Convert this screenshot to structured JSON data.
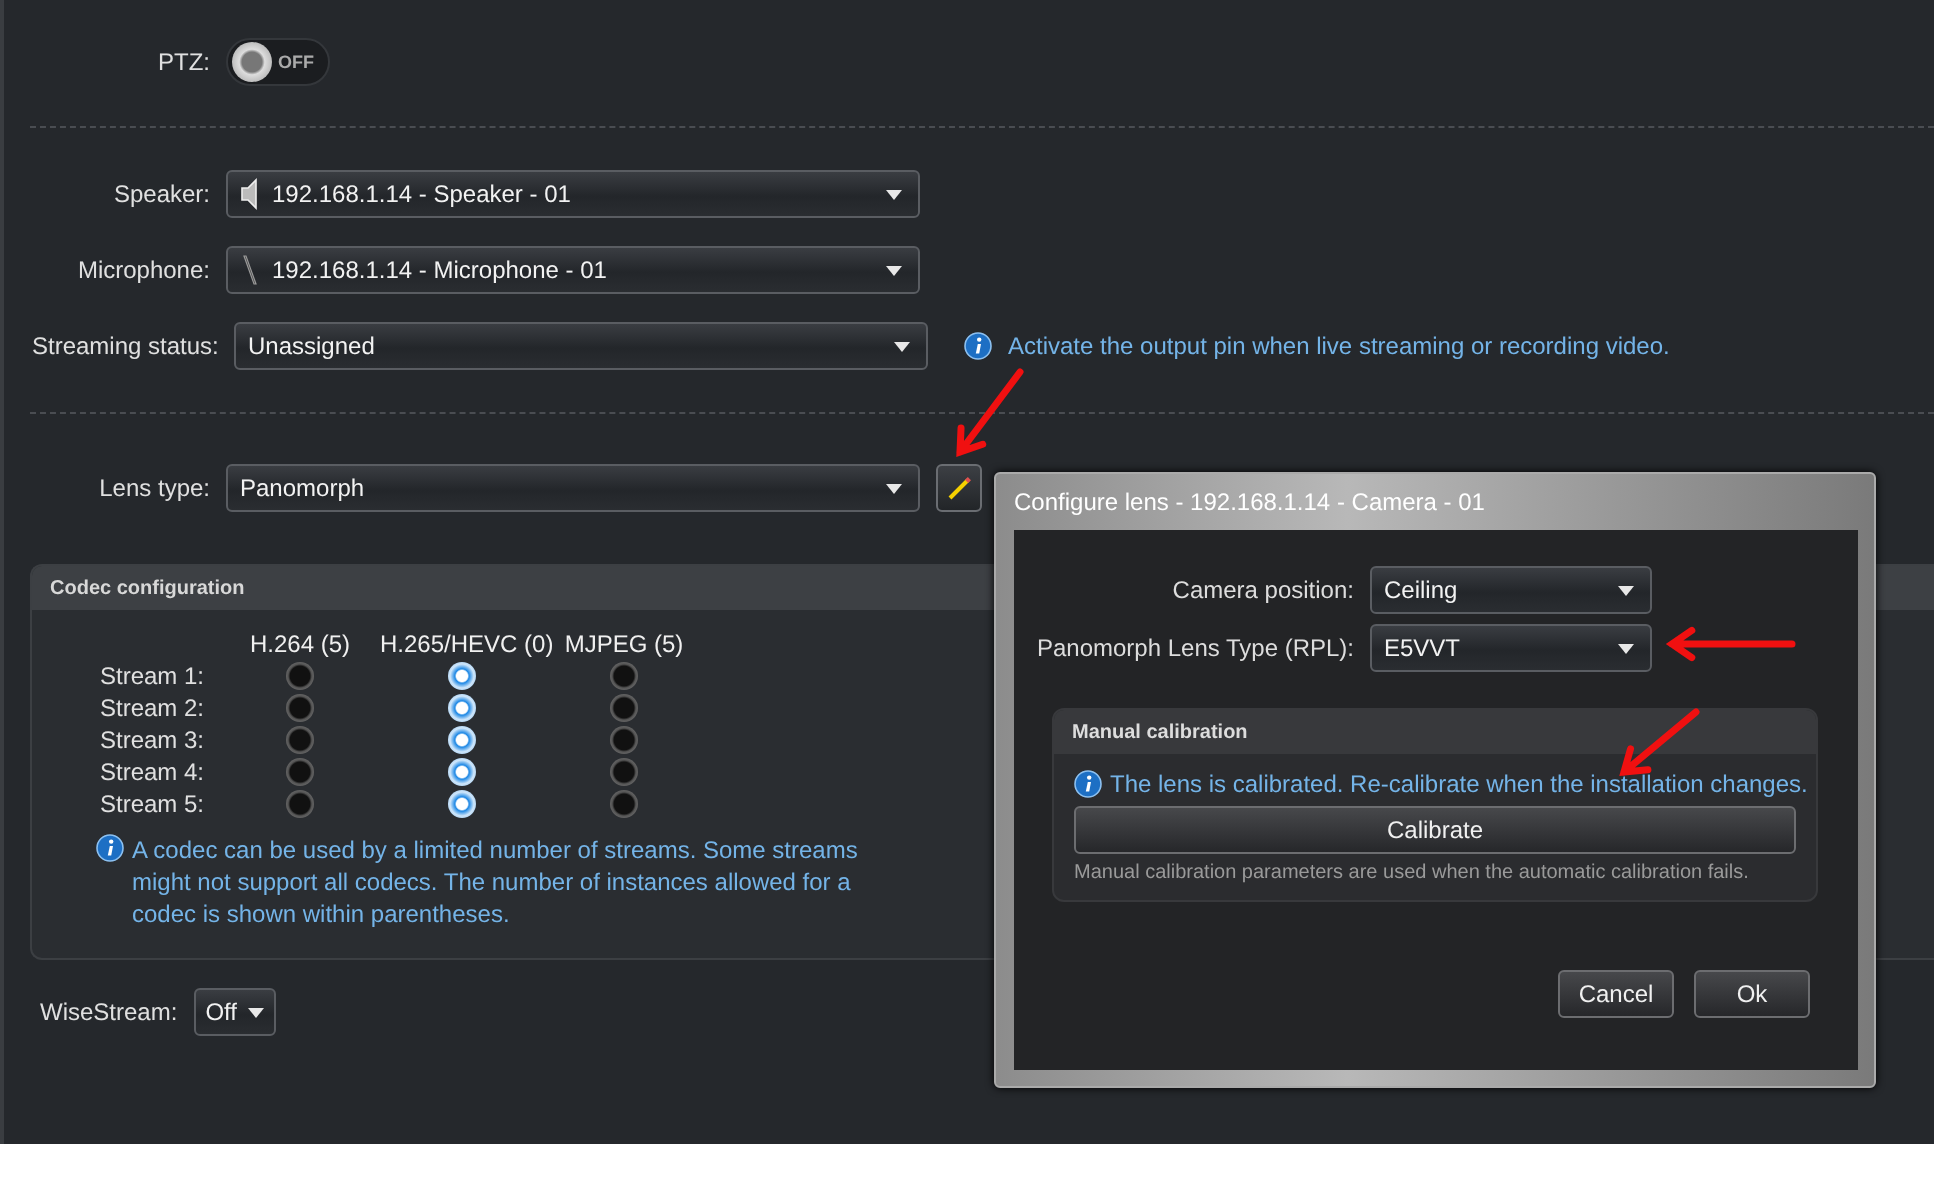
{
  "ptz": {
    "label": "PTZ:",
    "state_text": "OFF",
    "on": false
  },
  "devices": [
    {
      "kind": "speaker",
      "label": "Speaker:",
      "value": "192.168.1.14 - Speaker - 01"
    },
    {
      "kind": "microphone",
      "label": "Microphone:",
      "value": "192.168.1.14 - Microphone - 01"
    }
  ],
  "streaming_status": {
    "label": "Streaming status:",
    "value": "Unassigned",
    "info": "Activate the output pin when live streaming or recording video."
  },
  "lens_type": {
    "label": "Lens type:",
    "value": "Panomorph"
  },
  "codec_configuration": {
    "title": "Codec configuration",
    "columns": [
      "H.264 (5)",
      "H.265/HEVC (0)",
      "MJPEG (5)"
    ],
    "streams": [
      {
        "label": "Stream 1:",
        "options": [
          {
            "selected": false
          },
          {
            "selected": true
          },
          {
            "selected": false
          }
        ]
      },
      {
        "label": "Stream 2:",
        "options": [
          {
            "selected": false
          },
          {
            "selected": true
          },
          {
            "selected": false
          }
        ]
      },
      {
        "label": "Stream 3:",
        "options": [
          {
            "selected": false
          },
          {
            "selected": true
          },
          {
            "selected": false
          }
        ]
      },
      {
        "label": "Stream 4:",
        "options": [
          {
            "selected": false
          },
          {
            "selected": true
          },
          {
            "selected": false
          }
        ]
      },
      {
        "label": "Stream 5:",
        "options": [
          {
            "selected": false
          },
          {
            "selected": true
          },
          {
            "selected": false
          }
        ]
      }
    ],
    "info": "A codec can be used by a limited number of streams. Some streams might not support all codecs. The number of instances allowed for a codec is shown within parentheses."
  },
  "wisestream": {
    "label": "WiseStream:",
    "value": "Off"
  },
  "dialog": {
    "title": "Configure lens - 192.168.1.14 - Camera - 01",
    "fields": [
      {
        "label": "Camera position:",
        "value": "Ceiling"
      },
      {
        "label": "Panomorph Lens Type (RPL):",
        "value": "E5VVT"
      }
    ],
    "manual_calibration": {
      "title": "Manual calibration",
      "info": "The lens is calibrated. Re-calibrate when the installation changes.",
      "button": "Calibrate",
      "note": "Manual calibration parameters are used when the automatic calibration fails."
    },
    "buttons": [
      "Cancel",
      "Ok"
    ]
  }
}
